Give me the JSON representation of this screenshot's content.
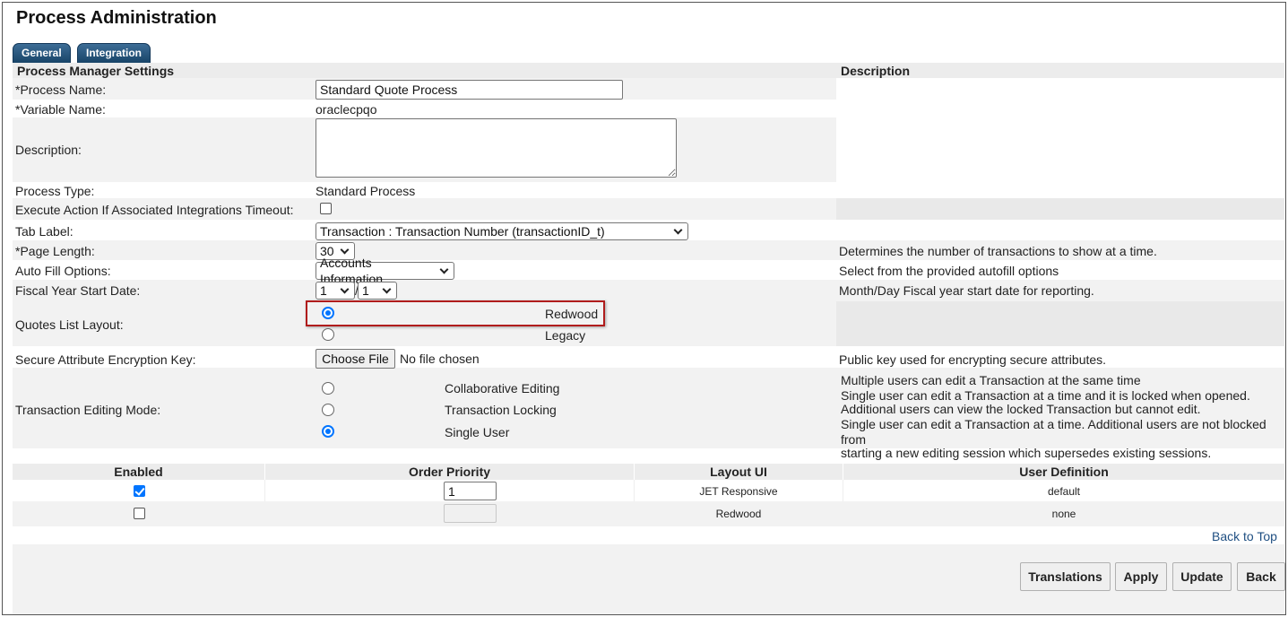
{
  "page": {
    "title": "Process Administration",
    "tabs": [
      {
        "label": "General"
      },
      {
        "label": "Integration"
      }
    ]
  },
  "settings": {
    "header": "Process Manager Settings",
    "description_header": "Description",
    "process_name": {
      "label": "*Process Name:",
      "value": "Standard Quote Process"
    },
    "variable_name": {
      "label": "*Variable Name:",
      "value": "oraclecpqo"
    },
    "description": {
      "label": "Description:",
      "value": ""
    },
    "process_type": {
      "label": "Process Type:",
      "value": "Standard Process"
    },
    "execute_action": {
      "label": "Execute Action If Associated Integrations Timeout:",
      "checked": false
    },
    "tab_label": {
      "label": "Tab Label:",
      "value": "Transaction : Transaction Number (transactionID_t)"
    },
    "page_length": {
      "label": "*Page Length:",
      "value": "30",
      "description": "Determines the number of transactions to show at a time."
    },
    "auto_fill": {
      "label": "Auto Fill Options:",
      "value": "Accounts Information",
      "description": "Select from the provided autofill options"
    },
    "fiscal_year": {
      "label": "Fiscal Year Start Date:",
      "month": "1",
      "separator": "/",
      "day": "1",
      "description": "Month/Day Fiscal year start date for reporting."
    },
    "quotes_layout": {
      "label": "Quotes List Layout:",
      "options": [
        {
          "label": "Redwood",
          "checked": true
        },
        {
          "label": "Legacy",
          "checked": false
        }
      ]
    },
    "encryption_key": {
      "label": "Secure Attribute Encryption Key:",
      "button": "Choose File",
      "status": "No file chosen",
      "description": "Public key used for encrypting secure attributes."
    },
    "editing_mode": {
      "label": "Transaction Editing Mode:",
      "options": [
        {
          "label": "Collaborative Editing",
          "checked": false
        },
        {
          "label": "Transaction Locking",
          "checked": false
        },
        {
          "label": "Single User",
          "checked": true
        }
      ],
      "descriptions": [
        "Multiple users can edit a Transaction at the same time",
        "Single user can edit a Transaction at a time and it is locked when opened.",
        "Additional users can view the locked Transaction but cannot edit.",
        "Single user can edit a Transaction at a time. Additional users are not blocked from",
        "starting a new editing session which supersedes existing sessions."
      ]
    }
  },
  "layouts_table": {
    "headers": [
      "Enabled",
      "Order Priority",
      "Layout UI",
      "User Definition"
    ],
    "rows": [
      {
        "enabled": true,
        "order": "1",
        "layout": "JET Responsive",
        "user_definition": "default"
      },
      {
        "enabled": false,
        "order": "",
        "layout": "Redwood",
        "user_definition": "none"
      }
    ]
  },
  "footer": {
    "back_to_top": "Back to Top",
    "buttons": [
      "Translations",
      "Apply",
      "Update",
      "Back"
    ]
  }
}
